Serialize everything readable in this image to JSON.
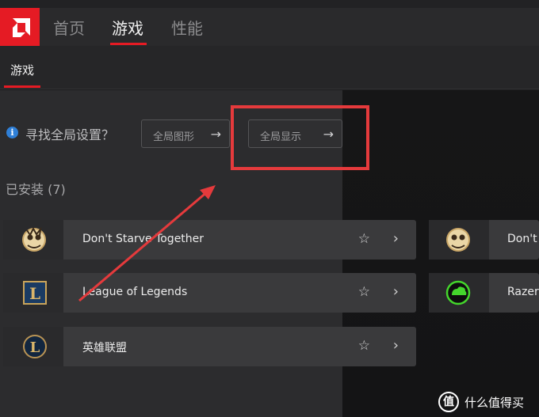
{
  "nav": {
    "items": [
      {
        "label": "首页",
        "active": false
      },
      {
        "label": "游戏",
        "active": true
      },
      {
        "label": "性能",
        "active": false
      }
    ]
  },
  "subnav": {
    "tab": "游戏"
  },
  "hint": {
    "question": "寻找全局设置？",
    "buttons": [
      {
        "label": "全局图形",
        "icon": "arrow-right-icon"
      },
      {
        "label": "全局显示",
        "icon": "arrow-right-icon"
      }
    ]
  },
  "installed": {
    "label": "已安装 (7)"
  },
  "games_left": [
    {
      "title": "Don't Starve Together",
      "icon": "dont-starve-icon"
    },
    {
      "title": "League of Legends",
      "icon": "league-of-legends-icon"
    },
    {
      "title": "英雄联盟",
      "icon": "league-of-legends-icon"
    }
  ],
  "games_right": [
    {
      "title": "Don't S",
      "icon": "dont-starve-icon"
    },
    {
      "title": "Razer S",
      "icon": "razer-cortex-icon"
    }
  ],
  "watermark": {
    "icon_text": "值",
    "text": "什么值得买"
  },
  "colors": {
    "accent": "#e51b24",
    "annotation": "#e53a3c"
  }
}
